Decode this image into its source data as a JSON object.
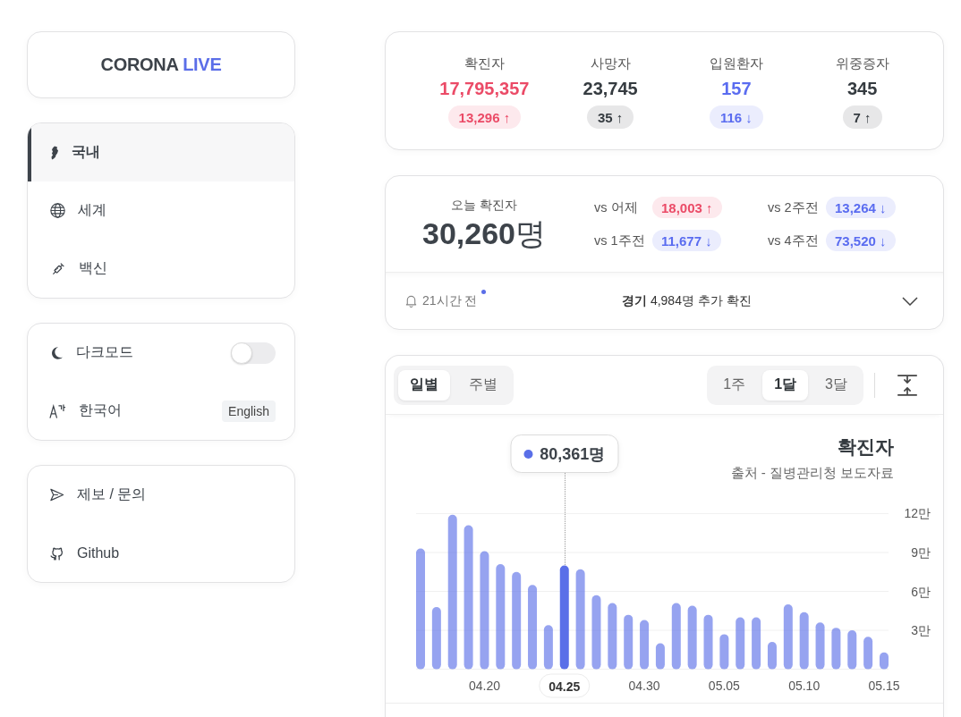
{
  "sidebar": {
    "logo": {
      "text": "CORONA",
      "highlight": "LIVE"
    },
    "nav": [
      {
        "label": "국내",
        "selected": true
      },
      {
        "label": "세계",
        "selected": false
      },
      {
        "label": "백신",
        "selected": false
      }
    ],
    "settings": [
      {
        "kind": "toggle",
        "label": "다크모드",
        "on": false
      },
      {
        "kind": "language",
        "label": "한국어",
        "button": "English"
      }
    ],
    "links": [
      {
        "label": "제보 / 문의"
      },
      {
        "label": "Github"
      }
    ]
  },
  "stats": [
    {
      "label": "확진자",
      "value": "17,795,357",
      "change": "13,296 ↑",
      "color": "#eb4b67"
    },
    {
      "label": "사망자",
      "value": "23,745",
      "change": "35 ↑",
      "color": "#353b40"
    },
    {
      "label": "입원환자",
      "value": "157",
      "change": "116 ↓",
      "color": "#5a6cf0"
    },
    {
      "label": "위중증자",
      "value": "345",
      "change": "7 ↑",
      "color": "#353b40"
    }
  ],
  "today": {
    "label": "오늘 확진자",
    "value": "**30,260**명",
    "comparisons": [
      {
        "label": "vs 어제",
        "value": "18,003 ↑",
        "color": "#eb4b67"
      },
      {
        "label": "vs 2주전",
        "value": "13,264 ↓",
        "color": "#5a6cf0"
      },
      {
        "label": "vs 1주전",
        "value": "11,677 ↓",
        "color": "#5a6cf0"
      },
      {
        "label": "vs 4주전",
        "value": "73,520 ↓",
        "color": "#5a6cf0"
      }
    ],
    "notice": {
      "time": "21시간 전",
      "unread": true,
      "message": "**경기** 4,984명 추가 확진",
      "expanded": false
    }
  },
  "chart": {
    "view_tabs": [
      {
        "label": "일별",
        "selected": true
      },
      {
        "label": "주별",
        "selected": false
      }
    ],
    "range_tabs": [
      {
        "label": "1주",
        "selected": false
      },
      {
        "label": "1달",
        "selected": true
      },
      {
        "label": "3달",
        "selected": false
      }
    ],
    "source": "출처 - 질병관리청 보도자료",
    "chart_data": {
      "type": "bar",
      "title": "확진자",
      "categories": [
        null,
        null,
        null,
        null,
        "04.20",
        null,
        null,
        null,
        null,
        "04.25",
        null,
        null,
        null,
        null,
        "04.30",
        null,
        null,
        null,
        null,
        "05.05",
        null,
        null,
        null,
        null,
        "05.10",
        null,
        null,
        null,
        null,
        "05.15"
      ],
      "series": [
        {
          "color": "#5a6fe8",
          "values": [
            9.3,
            4.8,
            11.9,
            11.1,
            9.1,
            8.1,
            7.5,
            6.5,
            3.4,
            8.0,
            7.7,
            5.7,
            5.1,
            4.2,
            3.8,
            2.0,
            5.1,
            4.9,
            4.2,
            2.7,
            4.0,
            4.0,
            2.1,
            5.0,
            4.4,
            3.6,
            3.2,
            3.0,
            2.5,
            1.3
          ]
        }
      ],
      "ylim": [
        0,
        12
      ],
      "yticks": [
        {
          "value": 3,
          "label": "3만"
        },
        {
          "value": 6,
          "label": "6만"
        },
        {
          "value": 9,
          "label": "9만"
        },
        {
          "value": 12,
          "label": "12만"
        }
      ],
      "grid": true,
      "annotations": [
        {
          "x": "04.25",
          "text": "80,361명"
        }
      ]
    }
  }
}
